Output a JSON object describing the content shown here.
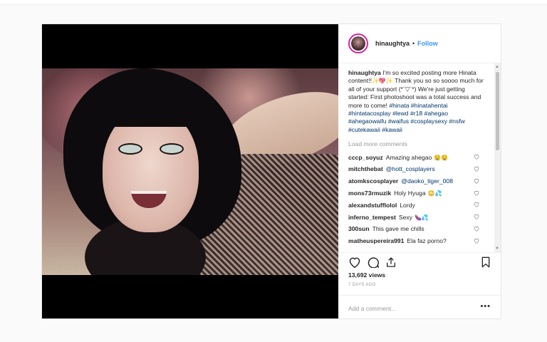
{
  "post": {
    "username": "hinaughtya",
    "separator": "•",
    "follow_label": "Follow",
    "caption_text_1": "I'm so excited posting more Hinata content!!",
    "caption_text_2": "Thank you so so soooo much for all of your support (*´▽`*) We're just getting started: First photoshoot was a total success and more to come!",
    "hashtags": "#hinata #hinatahentai #hintatacosplay #lewd #r18 #ahegao #ahegaowaifu #waifus #cosplaysexy #nsfw #cutekawaii #kawaii",
    "load_more": "Load more comments",
    "comments": [
      {
        "user": "cccp_soyuz",
        "text": "Amazing ahegao",
        "emoji": "🤤🤤"
      },
      {
        "user": "mitchthebat",
        "text": "",
        "mention": "@hott_cosplayers",
        "emoji": ""
      },
      {
        "user": "atomkscosplayer",
        "text": "",
        "mention": "@daoko_tiger_008",
        "emoji": ""
      },
      {
        "user": "mons73rmuzik",
        "text": "Holy Hyuga",
        "emoji": "😳💦"
      },
      {
        "user": "alexandstufflolol",
        "text": "Lordy",
        "emoji": ""
      },
      {
        "user": "inferno_tempest",
        "text": "Sexy",
        "emoji": "🍆💦"
      },
      {
        "user": "300sun",
        "text": "This gave me chills",
        "emoji": ""
      },
      {
        "user": "matheuspereira991",
        "text": "Ela faz porno?",
        "emoji": ""
      }
    ],
    "views": "13,692 views",
    "time_ago": "7 DAYS AGO",
    "add_comment_placeholder": "Add a comment...",
    "more_options": "•••",
    "caption_emoji_1": "✨💖✨"
  },
  "colors": {
    "link": "#3897f0",
    "hashtag": "#003569",
    "muted": "#999999",
    "text": "#262626"
  },
  "icons": [
    "heart-icon",
    "comment-icon",
    "share-icon",
    "bookmark-icon",
    "more-options-icon"
  ]
}
